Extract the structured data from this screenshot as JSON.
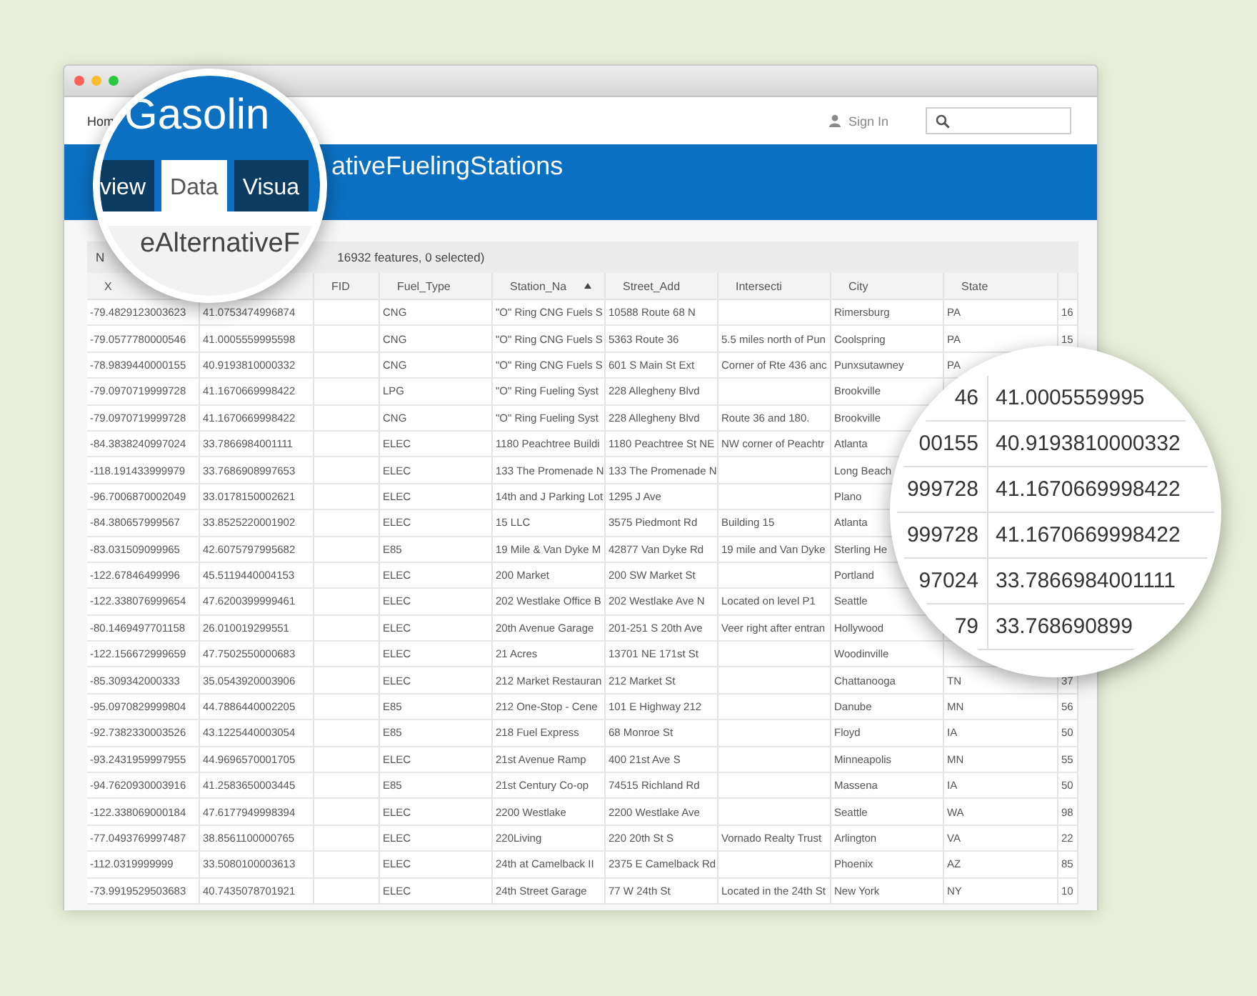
{
  "header": {
    "home_link": "Hom",
    "sign_in": "Sign In"
  },
  "banner": {
    "title": "ativeFuelingStations"
  },
  "table": {
    "caption_start": "N",
    "caption": "16932 features, 0 selected)",
    "columns": [
      {
        "label": "X",
        "sorted": false
      },
      {},
      {
        "label": "FID",
        "sorted": false
      },
      {
        "label": "Fuel_Type",
        "sorted": false
      },
      {
        "label": "Station_Na",
        "sorted": true
      },
      {
        "label": "Street_Add",
        "sorted": false
      },
      {
        "label": "Intersecti",
        "sorted": false
      },
      {
        "label": "City",
        "sorted": false
      },
      {
        "label": "State",
        "sorted": false
      }
    ],
    "rows": [
      {
        "cells": [
          "-79.4829123003623",
          "41.0753474996874",
          null,
          "CNG",
          "\"O\" Ring CNG Fuels S",
          "10588 Route 68 N",
          null,
          "Rimersburg",
          "PA",
          "16"
        ]
      },
      {
        "cells": [
          "-79.0577780000546",
          "41.0005559995598",
          null,
          "CNG",
          "\"O\" Ring CNG Fuels S",
          "5363 Route 36",
          "5.5 miles north of Pun",
          "Coolspring",
          "PA",
          "15"
        ]
      },
      {
        "cells": [
          "-78.9839440000155",
          "40.9193810000332",
          null,
          "CNG",
          "\"O\" Ring CNG Fuels S",
          "601 S Main St Ext",
          "Corner of Rte 436 anc",
          "Punxsutawney",
          "PA",
          null
        ]
      },
      {
        "cells": [
          "-79.0970719999728",
          "41.1670669998422",
          null,
          "LPG",
          "\"O\" Ring Fueling Syst",
          "228 Allegheny Blvd",
          null,
          "Brookville",
          null,
          null
        ]
      },
      {
        "cells": [
          "-79.0970719999728",
          "41.1670669998422",
          null,
          "CNG",
          "\"O\" Ring Fueling Syst",
          "228 Allegheny Blvd",
          "Route 36 and 180.",
          "Brookville",
          null,
          null
        ]
      },
      {
        "cells": [
          "-84.3838240997024",
          "33.7866984001111",
          null,
          "ELEC",
          "1180 Peachtree Buildi",
          "1180 Peachtree St NE",
          "NW corner of Peachtr",
          "Atlanta",
          null,
          null
        ]
      },
      {
        "cells": [
          "-118.191433999979",
          "33.7686908997653",
          null,
          "ELEC",
          "133 The Promenade N",
          "133 The Promenade N",
          null,
          "Long Beach",
          null,
          null
        ]
      },
      {
        "cells": [
          "-96.7006870002049",
          "33.0178150002621",
          null,
          "ELEC",
          "14th and J Parking Lot",
          "1295 J Ave",
          null,
          "Plano",
          null,
          null
        ]
      },
      {
        "cells": [
          "-84.380657999567",
          "33.8525220001902",
          null,
          "ELEC",
          "15 LLC",
          "3575 Piedmont Rd",
          "Building 15",
          "Atlanta",
          null,
          null
        ]
      },
      {
        "cells": [
          "-83.031509099965",
          "42.6075797995682",
          null,
          "E85",
          "19 Mile & Van Dyke M",
          "42877 Van Dyke Rd",
          "19 mile and Van Dyke",
          "Sterling He",
          null,
          null
        ]
      },
      {
        "cells": [
          "-122.67846499996",
          "45.5119440004153",
          null,
          "ELEC",
          "200 Market",
          "200 SW Market St",
          null,
          "Portland",
          null,
          null
        ]
      },
      {
        "cells": [
          "-122.338076999654",
          "47.6200399999461",
          null,
          "ELEC",
          "202 Westlake Office B",
          "202 Westlake Ave N",
          "Located on level P1",
          "Seattle",
          null,
          null
        ]
      },
      {
        "cells": [
          "-80.1469497701158",
          "26.010019299551",
          null,
          "ELEC",
          "20th Avenue Garage",
          "201-251 S 20th Ave",
          "Veer right after entran",
          "Hollywood",
          null,
          null
        ]
      },
      {
        "cells": [
          "-122.156672999659",
          "47.7502550000683",
          null,
          "ELEC",
          "21 Acres",
          "13701 NE 171st St",
          null,
          "Woodinville",
          null,
          null
        ]
      },
      {
        "cells": [
          "-85.309342000333",
          "35.0543920003906",
          null,
          "ELEC",
          "212 Market Restauran",
          "212 Market St",
          null,
          "Chattanooga",
          "TN",
          "37"
        ]
      },
      {
        "cells": [
          "-95.0970829999804",
          "44.7886440002205",
          null,
          "E85",
          "212 One-Stop - Cene",
          "101 E Highway 212",
          null,
          "Danube",
          "MN",
          "56"
        ]
      },
      {
        "cells": [
          "-92.7382330003526",
          "43.1225440003054",
          null,
          "E85",
          "218 Fuel Express",
          "68 Monroe St",
          null,
          "Floyd",
          "IA",
          "50"
        ]
      },
      {
        "cells": [
          "-93.2431959997955",
          "44.9696570001705",
          null,
          "ELEC",
          "21st Avenue Ramp",
          "400 21st Ave S",
          null,
          "Minneapolis",
          "MN",
          "55"
        ]
      },
      {
        "cells": [
          "-94.7620930003916",
          "41.2583650003445",
          null,
          "E85",
          "21st Century Co-op",
          "74515 Richland Rd",
          null,
          "Massena",
          "IA",
          "50"
        ]
      },
      {
        "cells": [
          "-122.338069000184",
          "47.6177949998394",
          null,
          "ELEC",
          "2200 Westlake",
          "2200 Westlake Ave",
          null,
          "Seattle",
          "WA",
          "98"
        ]
      },
      {
        "cells": [
          "-77.0493769997487",
          "38.8561100000765",
          null,
          "ELEC",
          "220Living",
          "220 20th St S",
          "Vornado Realty Trust",
          "Arlington",
          "VA",
          "22"
        ]
      },
      {
        "cells": [
          "-112.0319999999",
          "33.5080100003613",
          null,
          "ELEC",
          "24th at Camelback II",
          "2375 E Camelback Rd",
          null,
          "Phoenix",
          "AZ",
          "85"
        ]
      },
      {
        "cells": [
          "-73.9919529503683",
          "40.7435078701921",
          null,
          "ELEC",
          "24th Street Garage",
          "77 W 24th St",
          "Located in the 24th St",
          "New York",
          "NY",
          "10"
        ]
      }
    ]
  },
  "magnifiers": [
    {
      "kind": "header",
      "title": "Gasolin",
      "tabs": [
        {
          "label": "view",
          "selected": false
        },
        {
          "label": "Data",
          "selected": true
        },
        {
          "label": "Visua",
          "selected": false
        }
      ],
      "column_header": "eAlternativeF"
    },
    {
      "kind": "table",
      "rows": [
        {
          "cells": [
            "46",
            "41.0005559995"
          ]
        },
        {
          "cells": [
            "00155",
            "40.9193810000332"
          ]
        },
        {
          "cells": [
            "999728",
            "41.1670669998422"
          ]
        },
        {
          "cells": [
            "999728",
            "41.1670669998422"
          ]
        },
        {
          "cells": [
            "97024",
            "33.7866984001111"
          ]
        },
        {
          "cells": [
            "79",
            "33.768690899"
          ]
        }
      ]
    }
  ]
}
